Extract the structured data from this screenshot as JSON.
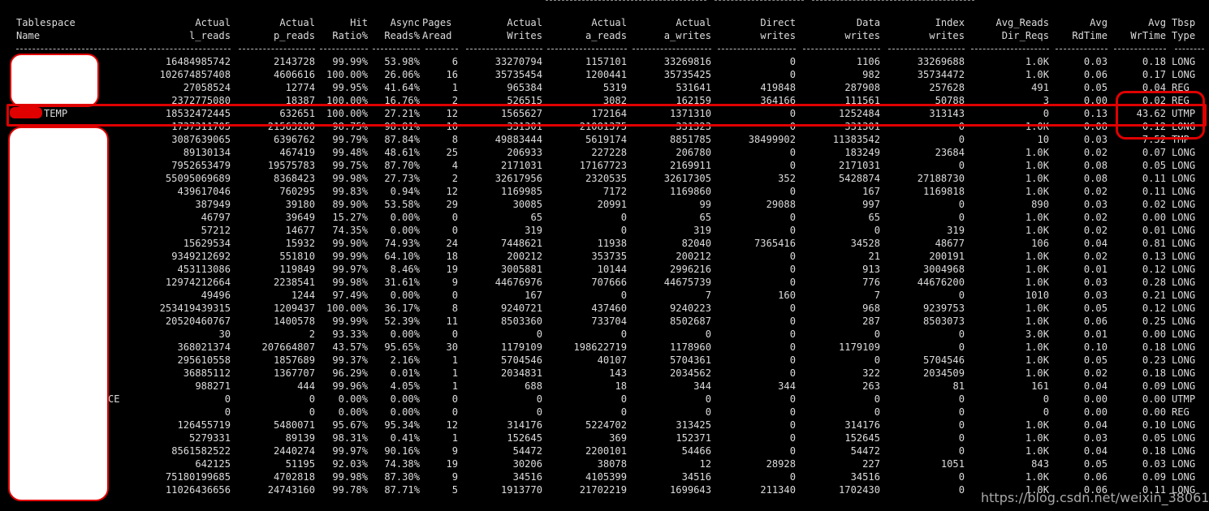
{
  "headers": [
    [
      "Tablespace",
      "Name"
    ],
    [
      "Actual",
      "l_reads"
    ],
    [
      "Actual",
      "p_reads"
    ],
    [
      "Hit",
      "Ratio%"
    ],
    [
      "Async",
      "Reads%"
    ],
    [
      "Pages",
      "Aread"
    ],
    [
      "Actual",
      "Writes"
    ],
    [
      "Actual",
      "a_reads"
    ],
    [
      "Actual",
      "a_writes"
    ],
    [
      "Direct",
      "writes"
    ],
    [
      "Data",
      "writes"
    ],
    [
      "Index",
      "writes"
    ],
    [
      "Avg_Reads",
      "Dir_Reqs"
    ],
    [
      "Avg",
      "RdTime"
    ],
    [
      "Avg",
      "WrTime"
    ],
    [
      "Tbsp",
      "Type"
    ]
  ],
  "rows": [
    [
      "",
      "16484985742",
      "2143728",
      "99.99%",
      "53.98%",
      "6",
      "33270794",
      "1157101",
      "33269816",
      "0",
      "1106",
      "33269688",
      "1.0K",
      "0.03",
      "0.18",
      "LONG"
    ],
    [
      "",
      "102674857408",
      "4606616",
      "100.00%",
      "26.06%",
      "16",
      "35735454",
      "1200441",
      "35735425",
      "0",
      "982",
      "35734472",
      "1.0K",
      "0.06",
      "0.17",
      "LONG"
    ],
    [
      "",
      "27058524",
      "12774",
      "99.95%",
      "41.64%",
      "1",
      "965384",
      "5319",
      "531641",
      "419848",
      "287908",
      "257628",
      "491",
      "0.05",
      "0.04",
      "REG"
    ],
    [
      "",
      "2372775080",
      "18387",
      "100.00%",
      "16.76%",
      "2",
      "526515",
      "3082",
      "162159",
      "364166",
      "111561",
      "50788",
      "3",
      "0.00",
      "0.02",
      "REG"
    ],
    [
      "TEMP",
      "18532472445",
      "632651",
      "100.00%",
      "27.21%",
      "12",
      "1565627",
      "172164",
      "1371310",
      "0",
      "1252484",
      "313143",
      "0",
      "0.13",
      "43.62",
      "UTMP"
    ],
    [
      "",
      "1737311705",
      "21563280",
      "98.75%",
      "98.81%",
      "10",
      "331301",
      "21081375",
      "331323",
      "0",
      "331301",
      "0",
      "1.0K",
      "0.08",
      "0.12",
      "LONG"
    ],
    [
      "",
      "3087639065",
      "6396762",
      "99.79%",
      "87.84%",
      "8",
      "49883444",
      "5619174",
      "8851785",
      "38499902",
      "11383542",
      "0",
      "10",
      "0.03",
      "7.52",
      "TMP"
    ],
    [
      "",
      "89130134",
      "467419",
      "99.48%",
      "48.61%",
      "25",
      "206933",
      "227228",
      "206780",
      "0",
      "183249",
      "23684",
      "1.0K",
      "0.02",
      "0.07",
      "LONG"
    ],
    [
      "",
      "7952653479",
      "19575783",
      "99.75%",
      "87.70%",
      "4",
      "2171031",
      "17167723",
      "2169911",
      "0",
      "2171031",
      "0",
      "1.0K",
      "0.08",
      "0.05",
      "LONG"
    ],
    [
      "",
      "55095069689",
      "8368423",
      "99.98%",
      "27.73%",
      "2",
      "32617956",
      "2320535",
      "32617305",
      "352",
      "5428874",
      "27188730",
      "1.0K",
      "0.08",
      "0.11",
      "LONG"
    ],
    [
      "",
      "439617046",
      "760295",
      "99.83%",
      "0.94%",
      "12",
      "1169985",
      "7172",
      "1169860",
      "0",
      "167",
      "1169818",
      "1.0K",
      "0.02",
      "0.11",
      "LONG"
    ],
    [
      "",
      "387949",
      "39180",
      "89.90%",
      "53.58%",
      "29",
      "30085",
      "20991",
      "99",
      "29088",
      "997",
      "0",
      "890",
      "0.03",
      "0.02",
      "LONG"
    ],
    [
      "",
      "46797",
      "39649",
      "15.27%",
      "0.00%",
      "0",
      "65",
      "0",
      "65",
      "0",
      "65",
      "0",
      "1.0K",
      "0.02",
      "0.00",
      "LONG"
    ],
    [
      "",
      "57212",
      "14677",
      "74.35%",
      "0.00%",
      "0",
      "319",
      "0",
      "319",
      "0",
      "0",
      "319",
      "1.0K",
      "0.02",
      "0.01",
      "LONG"
    ],
    [
      "",
      "15629534",
      "15932",
      "99.90%",
      "74.93%",
      "24",
      "7448621",
      "11938",
      "82040",
      "7365416",
      "34528",
      "48677",
      "106",
      "0.04",
      "0.81",
      "LONG"
    ],
    [
      "",
      "9349212692",
      "551810",
      "99.99%",
      "64.10%",
      "18",
      "200212",
      "353735",
      "200212",
      "0",
      "21",
      "200191",
      "1.0K",
      "0.02",
      "0.13",
      "LONG"
    ],
    [
      "",
      "453113086",
      "119849",
      "99.97%",
      "8.46%",
      "19",
      "3005881",
      "10144",
      "2996216",
      "0",
      "913",
      "3004968",
      "1.0K",
      "0.01",
      "0.12",
      "LONG"
    ],
    [
      "",
      "12974212664",
      "2238541",
      "99.98%",
      "31.61%",
      "9",
      "44676976",
      "707666",
      "44675739",
      "0",
      "776",
      "44676200",
      "1.0K",
      "0.03",
      "0.28",
      "LONG"
    ],
    [
      "",
      "49496",
      "1244",
      "97.49%",
      "0.00%",
      "0",
      "167",
      "0",
      "7",
      "160",
      "7",
      "0",
      "1010",
      "0.03",
      "0.21",
      "LONG"
    ],
    [
      "",
      "253419439315",
      "1209437",
      "100.00%",
      "36.17%",
      "8",
      "9240721",
      "437460",
      "9240223",
      "0",
      "968",
      "9239753",
      "1.0K",
      "0.05",
      "0.12",
      "LONG"
    ],
    [
      "",
      "20520460767",
      "1400578",
      "99.99%",
      "52.39%",
      "11",
      "8503360",
      "733704",
      "8502687",
      "0",
      "287",
      "8503073",
      "1.0K",
      "0.06",
      "0.25",
      "LONG"
    ],
    [
      "",
      "30",
      "2",
      "93.33%",
      "0.00%",
      "0",
      "0",
      "0",
      "0",
      "0",
      "0",
      "0",
      "3.0K",
      "0.01",
      "0.00",
      "LONG"
    ],
    [
      "",
      "368021374",
      "207664807",
      "43.57%",
      "95.65%",
      "30",
      "1179109",
      "198622719",
      "1178960",
      "0",
      "1179109",
      "0",
      "1.0K",
      "0.10",
      "0.18",
      "LONG"
    ],
    [
      "",
      "295610558",
      "1857689",
      "99.37%",
      "2.16%",
      "1",
      "5704546",
      "40107",
      "5704361",
      "0",
      "0",
      "5704546",
      "1.0K",
      "0.05",
      "0.23",
      "LONG"
    ],
    [
      "",
      "36885112",
      "1367707",
      "96.29%",
      "0.01%",
      "1",
      "2034831",
      "143",
      "2034562",
      "0",
      "322",
      "2034509",
      "1.0K",
      "0.02",
      "0.18",
      "LONG"
    ],
    [
      "",
      "988271",
      "444",
      "99.96%",
      "4.05%",
      "1",
      "688",
      "18",
      "344",
      "344",
      "263",
      "81",
      "161",
      "0.04",
      "0.09",
      "LONG"
    ],
    [
      "CE",
      "0",
      "0",
      "0.00%",
      "0.00%",
      "0",
      "0",
      "0",
      "0",
      "0",
      "0",
      "0",
      "0",
      "0.00",
      "0.00",
      "UTMP"
    ],
    [
      "",
      "0",
      "0",
      "0.00%",
      "0.00%",
      "0",
      "0",
      "0",
      "0",
      "0",
      "0",
      "0",
      "0",
      "0.00",
      "0.00",
      "REG"
    ],
    [
      "",
      "126455719",
      "5480071",
      "95.67%",
      "95.34%",
      "12",
      "314176",
      "5224702",
      "313425",
      "0",
      "314176",
      "0",
      "1.0K",
      "0.04",
      "0.10",
      "LONG"
    ],
    [
      "",
      "5279331",
      "89139",
      "98.31%",
      "0.41%",
      "1",
      "152645",
      "369",
      "152371",
      "0",
      "152645",
      "0",
      "1.0K",
      "0.03",
      "0.05",
      "LONG"
    ],
    [
      "",
      "8561582522",
      "2440274",
      "99.97%",
      "90.16%",
      "9",
      "54472",
      "2200101",
      "54466",
      "0",
      "54472",
      "0",
      "1.0K",
      "0.04",
      "0.18",
      "LONG"
    ],
    [
      "",
      "642125",
      "51195",
      "92.03%",
      "74.38%",
      "19",
      "30206",
      "38078",
      "12",
      "28928",
      "227",
      "1051",
      "843",
      "0.05",
      "0.03",
      "LONG"
    ],
    [
      "",
      "75180199685",
      "4702818",
      "99.98%",
      "87.30%",
      "9",
      "34516",
      "4105399",
      "34516",
      "0",
      "34516",
      "0",
      "1.0K",
      "0.06",
      "0.09",
      "LONG"
    ],
    [
      "",
      "11026436656",
      "24743160",
      "99.78%",
      "87.71%",
      "5",
      "1913770",
      "21702219",
      "1699643",
      "211340",
      "1702430",
      "0",
      "1.0K",
      "0.06",
      "0.11",
      "LONG"
    ]
  ],
  "watermark": "https://blog.csdn.net/weixin_38061610"
}
